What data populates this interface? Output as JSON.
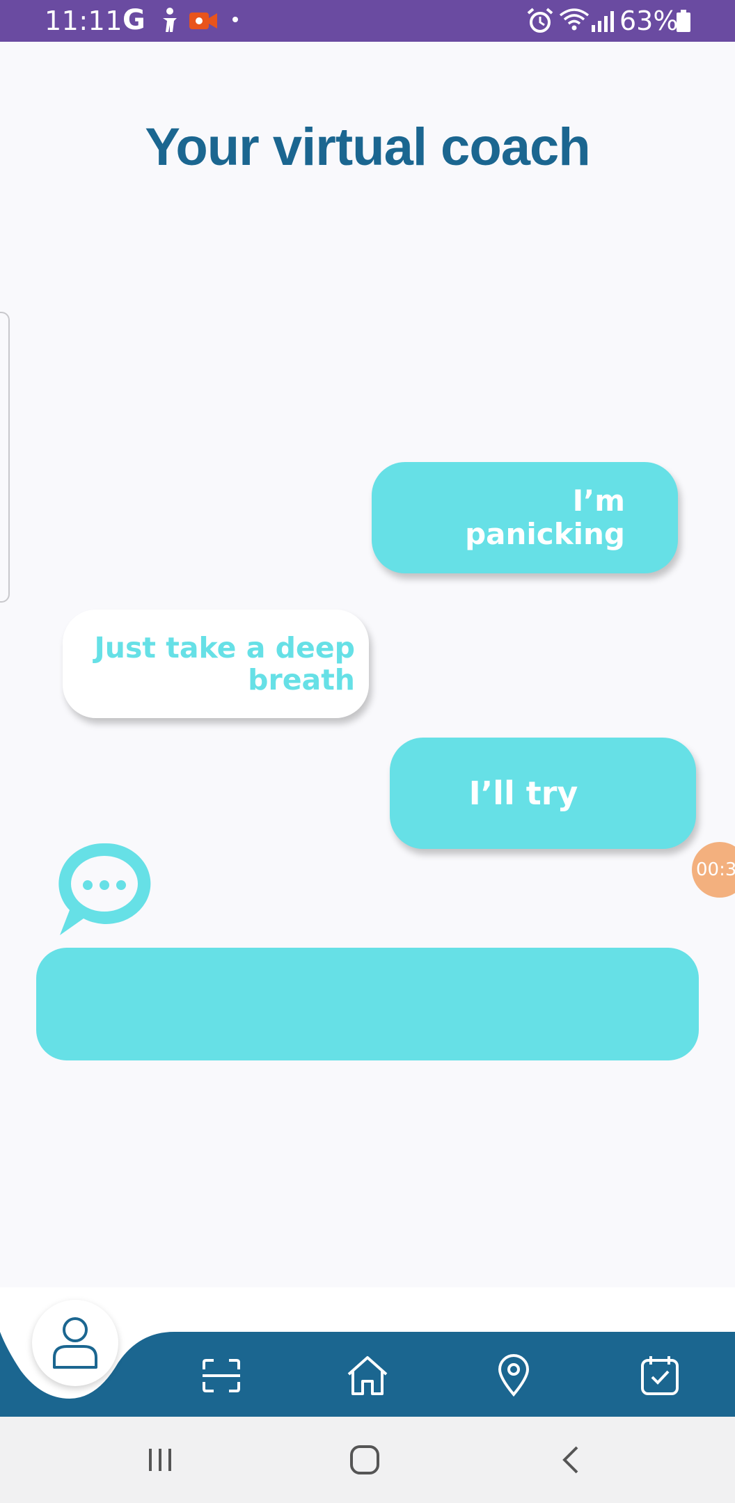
{
  "status_bar": {
    "time": "11:11",
    "g_label": "G",
    "battery_percent": "63%",
    "icons": [
      "google-icon",
      "accessibility-icon",
      "screen-record-icon",
      "alarm-icon",
      "wifi-icon",
      "signal-icon",
      "battery-icon"
    ],
    "background_color": "#6a4ba1"
  },
  "header": {
    "title": "Your virtual coach",
    "title_color": "#1b6690"
  },
  "chat": {
    "messages": [
      {
        "sender": "user",
        "text": "I’m panicking"
      },
      {
        "sender": "coach",
        "text": "Just take a deep breath"
      },
      {
        "sender": "user",
        "text": "I’ll try"
      }
    ],
    "typing_icon": "chat-typing-icon",
    "user_bubble_color": "#66e0e6",
    "coach_bubble_color": "#ffffff"
  },
  "timer_badge": {
    "text": "00:3",
    "color": "#f3b07e"
  },
  "input": {
    "value": "",
    "color": "#66e0e6"
  },
  "bottom_nav": {
    "background_color": "#1b6690",
    "items": [
      {
        "icon": "profile-icon",
        "active": true
      },
      {
        "icon": "scan-icon",
        "active": false
      },
      {
        "icon": "home-icon",
        "active": false
      },
      {
        "icon": "location-pin-icon",
        "active": false
      },
      {
        "icon": "calendar-check-icon",
        "active": false
      }
    ]
  },
  "system_nav": {
    "buttons": [
      "recent-apps-icon",
      "home-button-icon",
      "back-icon"
    ]
  }
}
